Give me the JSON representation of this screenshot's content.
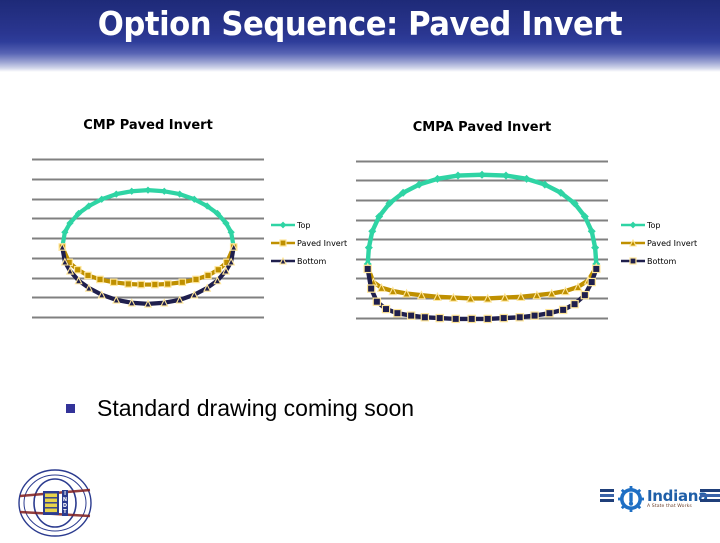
{
  "slide": {
    "title": "Option Sequence: Paved Invert",
    "bullet": {
      "marker": "square-bullet",
      "text": "Standard drawing coming soon"
    }
  },
  "colors": {
    "banner_navy": "#2a3690",
    "banner_navy_dark": "#1e2a78",
    "title_text": "#ffffff",
    "bullet": "#333399",
    "gridline": "#808080",
    "series_top": "#2fd4a4",
    "series_paved_invert": "#bf9000",
    "series_paved_invert_fill": "#d4a017",
    "series_bottom": "#1f1f4d",
    "marker_outline": "#ffe699",
    "indiana_blue": "#1f5fa8",
    "indot_seal": "#2b3b8f"
  },
  "logos": {
    "left": {
      "name": "indot-seal-logo",
      "alt": "Indiana Department of Transportation seal",
      "word": "INDOT"
    },
    "right": {
      "name": "indiana-state-logo",
      "title": "Indiana",
      "tagline": "A State that Works"
    }
  },
  "charts": [
    {
      "id": "cmp-paved-invert",
      "title": "CMP Paved Invert",
      "legend_position": "right",
      "legend": [
        {
          "label": "Top",
          "color": "#2fd4a4",
          "marker": "diamond"
        },
        {
          "label": "Paved Invert",
          "color": "#bf9000",
          "marker": "square"
        },
        {
          "label": "Bottom",
          "color": "#1f1f4d",
          "marker": "triangle"
        }
      ],
      "chart_data": {
        "type": "line",
        "title": "CMP Paved Invert",
        "xlabel": "",
        "ylabel": "",
        "grid": true,
        "gridlines": 9,
        "xlim": [
          -1.05,
          1.05
        ],
        "ylim": [
          -1.6,
          1.6
        ],
        "legend_position": "right",
        "shape": "circular corrugated metal pipe cross-section",
        "series": [
          {
            "name": "Top",
            "color": "#2fd4a4",
            "marker": "diamond",
            "x": [
              -1.0,
              -0.97,
              -0.91,
              -0.81,
              -0.69,
              -0.54,
              -0.37,
              -0.19,
              0.0,
              0.19,
              0.37,
              0.54,
              0.69,
              0.81,
              0.91,
              0.97,
              1.0
            ],
            "y": [
              0.0,
              0.26,
              0.42,
              0.59,
              0.72,
              0.84,
              0.93,
              0.98,
              1.0,
              0.98,
              0.93,
              0.84,
              0.72,
              0.59,
              0.42,
              0.26,
              0.0
            ]
          },
          {
            "name": "Paved Invert",
            "color": "#bf9000",
            "marker": "square",
            "x": [
              -1.0,
              -0.92,
              -0.82,
              -0.7,
              -0.56,
              -0.4,
              -0.23,
              -0.08,
              0.08,
              0.23,
              0.4,
              0.56,
              0.7,
              0.82,
              0.92,
              1.0
            ],
            "y": [
              0.0,
              -0.27,
              -0.4,
              -0.5,
              -0.57,
              -0.62,
              -0.65,
              -0.66,
              -0.66,
              -0.65,
              -0.62,
              -0.57,
              -0.5,
              -0.4,
              -0.27,
              0.0
            ]
          },
          {
            "name": "Bottom",
            "color": "#1f1f4d",
            "marker": "triangle",
            "x": [
              -1.0,
              -0.97,
              -0.91,
              -0.81,
              -0.69,
              -0.54,
              -0.37,
              -0.19,
              0.0,
              0.19,
              0.37,
              0.54,
              0.69,
              0.81,
              0.91,
              0.97,
              1.0
            ],
            "y": [
              0.0,
              -0.26,
              -0.42,
              -0.59,
              -0.72,
              -0.84,
              -0.93,
              -0.98,
              -1.0,
              -0.98,
              -0.93,
              -0.84,
              -0.72,
              -0.59,
              -0.42,
              -0.26,
              0.0
            ]
          }
        ]
      }
    },
    {
      "id": "cmpa-paved-invert",
      "title": "CMPA Paved Invert",
      "legend_position": "right",
      "legend": [
        {
          "label": "Top",
          "color": "#2fd4a4",
          "marker": "diamond"
        },
        {
          "label": "Paved Invert",
          "color": "#bf9000",
          "marker": "triangle"
        },
        {
          "label": "Bottom",
          "color": "#1f1f4d",
          "marker": "square"
        }
      ],
      "chart_data": {
        "type": "line",
        "title": "CMPA Paved Invert",
        "xlabel": "",
        "ylabel": "",
        "grid": true,
        "gridlines": 9,
        "xlim": [
          -1.05,
          1.05
        ],
        "ylim": [
          -1.05,
          1.05
        ],
        "legend_position": "right",
        "shape": "corrugated metal pipe arch cross-section",
        "series": [
          {
            "name": "Top",
            "color": "#2fd4a4",
            "marker": "diamond",
            "x": [
              -1.0,
              -0.99,
              -0.96,
              -0.9,
              -0.81,
              -0.69,
              -0.55,
              -0.39,
              -0.21,
              0.0,
              0.21,
              0.39,
              0.55,
              0.69,
              0.81,
              0.9,
              0.96,
              0.99,
              1.0
            ],
            "y": [
              -0.22,
              -0.02,
              0.18,
              0.36,
              0.52,
              0.65,
              0.75,
              0.82,
              0.86,
              0.87,
              0.86,
              0.82,
              0.75,
              0.65,
              0.52,
              0.36,
              0.18,
              -0.02,
              -0.22
            ]
          },
          {
            "name": "Paved Invert",
            "color": "#bf9000",
            "marker": "triangle",
            "x": [
              -1.0,
              -0.95,
              -0.88,
              -0.78,
              -0.66,
              -0.53,
              -0.39,
              -0.25,
              -0.1,
              0.05,
              0.2,
              0.34,
              0.48,
              0.61,
              0.73,
              0.84,
              0.93,
              1.0
            ],
            "y": [
              -0.26,
              -0.44,
              -0.51,
              -0.55,
              -0.58,
              -0.6,
              -0.62,
              -0.63,
              -0.64,
              -0.64,
              -0.63,
              -0.62,
              -0.6,
              -0.58,
              -0.55,
              -0.5,
              -0.42,
              -0.26
            ]
          },
          {
            "name": "Bottom",
            "color": "#1f1f4d",
            "marker": "square",
            "x": [
              -1.0,
              -0.97,
              -0.92,
              -0.84,
              -0.74,
              -0.62,
              -0.5,
              -0.37,
              -0.23,
              -0.09,
              0.05,
              0.19,
              0.33,
              0.46,
              0.59,
              0.71,
              0.81,
              0.9,
              0.96,
              1.0
            ],
            "y": [
              -0.28,
              -0.52,
              -0.68,
              -0.77,
              -0.82,
              -0.85,
              -0.87,
              -0.88,
              -0.89,
              -0.89,
              -0.89,
              -0.88,
              -0.87,
              -0.85,
              -0.82,
              -0.78,
              -0.71,
              -0.6,
              -0.44,
              -0.28
            ]
          }
        ]
      }
    }
  ]
}
